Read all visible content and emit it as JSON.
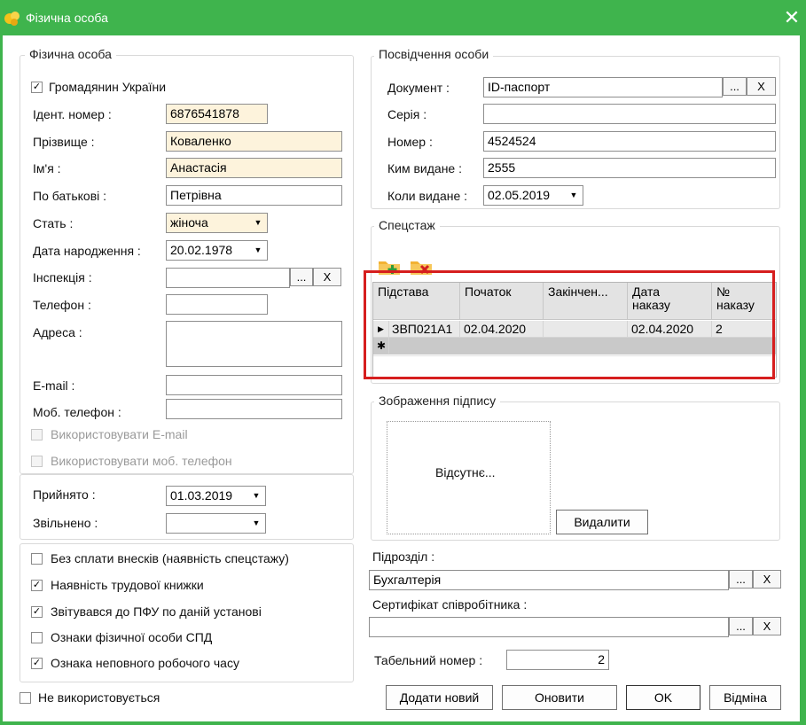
{
  "window": {
    "title": "Фізична особа",
    "close_glyph": "✕"
  },
  "person": {
    "legend": "Фізична особа",
    "citizen": {
      "label": "Громадянин України",
      "checked": "✓"
    },
    "ident": {
      "label": "Ідент. номер :",
      "value": "6876541878"
    },
    "surname": {
      "label": "Прізвище :",
      "value": "Коваленко"
    },
    "name": {
      "label": "Ім'я :",
      "value": "Анастасія"
    },
    "patronymic": {
      "label": "По батькові :",
      "value": "Петрівна"
    },
    "gender": {
      "label": "Стать :",
      "value": "жіноча"
    },
    "birthdate": {
      "label": "Дата народження :",
      "value": "20.02.1978"
    },
    "inspection": {
      "label": "Інспекція :",
      "value": ""
    },
    "phone": {
      "label": "Телефон :",
      "value": ""
    },
    "address": {
      "label": "Адреса :",
      "value": ""
    },
    "email": {
      "label": "E-mail :",
      "value": ""
    },
    "mobile": {
      "label": "Моб. телефон :",
      "value": ""
    },
    "use_email": {
      "label": "Використовувати E-mail"
    },
    "use_mobile": {
      "label": "Використовувати моб. телефон"
    }
  },
  "employment": {
    "hired": {
      "label": "Прийнято :",
      "value": "01.03.2019"
    },
    "fired": {
      "label": "Звільнено :",
      "value": ""
    }
  },
  "flags": [
    {
      "label": "Без сплати внесків (наявність спецстажу)",
      "checked": ""
    },
    {
      "label": "Наявність трудової книжки",
      "checked": "✓"
    },
    {
      "label": "Звітувався до ПФУ по даній установі",
      "checked": "✓"
    },
    {
      "label": "Ознаки фізичної особи СПД",
      "checked": ""
    },
    {
      "label": "Ознака неповного робочого часу",
      "checked": "✓"
    }
  ],
  "not_used": {
    "label": "Не використовується",
    "checked": ""
  },
  "id_doc": {
    "legend": "Посвідчення особи",
    "document": {
      "label": "Документ :",
      "value": "ID-паспорт"
    },
    "series": {
      "label": "Серія :",
      "value": ""
    },
    "number": {
      "label": "Номер :",
      "value": "4524524"
    },
    "issued_by": {
      "label": "Ким видане :",
      "value": "2555"
    },
    "issued_on": {
      "label": "Коли видане :",
      "value": "02.05.2019"
    }
  },
  "browse_label": "...",
  "clear_label": "X",
  "special": {
    "legend": "Спецстаж",
    "columns": [
      "Підстава",
      "Початок",
      "Закінчен...",
      "Дата\nнаказу",
      "№\nнаказу"
    ],
    "rows": [
      {
        "marker": "▶",
        "basis": "ЗВП021А1",
        "start": "02.04.2020",
        "end": "",
        "order_date": "02.04.2020",
        "order_no": "2"
      }
    ],
    "new_row_marker": "✱"
  },
  "signature": {
    "legend": "Зображення підпису",
    "placeholder": "Відсутнє...",
    "delete_label": "Видалити"
  },
  "department": {
    "label": "Підрозділ :",
    "value": "Бухгалтерія"
  },
  "certificate": {
    "label": "Сертифікат співробітника :",
    "value": ""
  },
  "tab_number": {
    "label": "Табельний номер :",
    "value": "2"
  },
  "buttons": {
    "add": "Додати новий",
    "refresh": "Оновити",
    "ok": "OK",
    "cancel": "Відміна"
  },
  "colors": {
    "accent": "#3fb44d",
    "highlight": "#d61e1e",
    "required_bg": "#fdf3dc"
  }
}
